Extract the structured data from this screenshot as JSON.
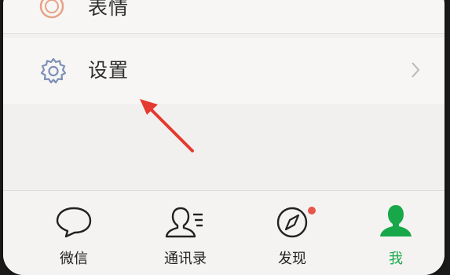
{
  "menu": {
    "stickers_label": "表情",
    "settings_label": "设置"
  },
  "tabs": [
    {
      "label": "微信",
      "icon": "chat-bubble-icon"
    },
    {
      "label": "通讯录",
      "icon": "contacts-icon"
    },
    {
      "label": "发现",
      "icon": "compass-icon",
      "badge": "red-dot"
    },
    {
      "label": "我",
      "icon": "person-icon",
      "active": true
    }
  ],
  "colors": {
    "accent_green": "#18a84a",
    "annotation_red": "#e53a2f",
    "badge_red": "#e8564a",
    "icon_blue": "#7d8fb8"
  }
}
